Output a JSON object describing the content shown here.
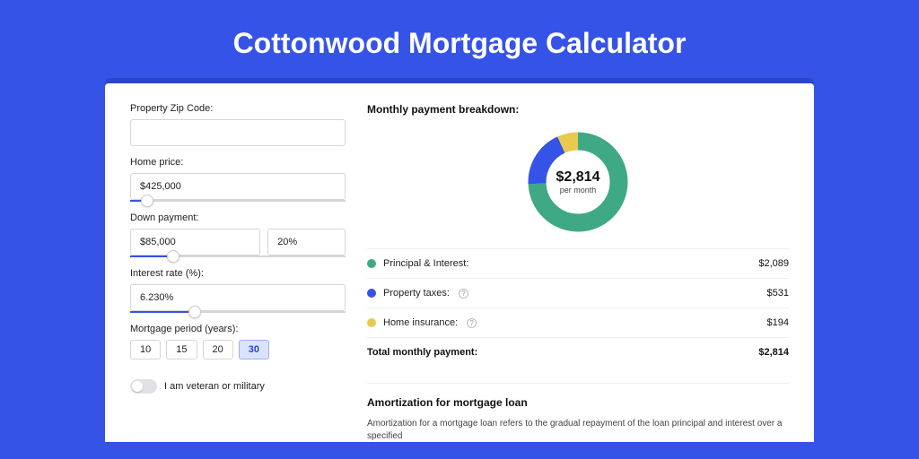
{
  "title": "Cottonwood Mortgage Calculator",
  "form": {
    "zip_label": "Property Zip Code:",
    "zip_value": "",
    "home_price_label": "Home price:",
    "home_price_value": "$425,000",
    "home_price_slider_pct": 8,
    "down_payment_label": "Down payment:",
    "down_payment_value": "$85,000",
    "down_payment_pct_value": "20%",
    "down_payment_slider_pct": 20,
    "interest_label": "Interest rate (%):",
    "interest_value": "6.230%",
    "interest_slider_pct": 30,
    "period_label": "Mortgage period (years):",
    "periods": [
      "10",
      "15",
      "20",
      "30"
    ],
    "period_selected": "30",
    "veteran_label": "I am veteran or military",
    "veteran_on": false
  },
  "breakdown": {
    "title": "Monthly payment breakdown:",
    "center_amount": "$2,814",
    "center_sub": "per month",
    "items": [
      {
        "label": "Principal & Interest:",
        "value": "$2,089",
        "color": "#3fa885",
        "info": false
      },
      {
        "label": "Property taxes:",
        "value": "$531",
        "color": "#3653e8",
        "info": true
      },
      {
        "label": "Home insurance:",
        "value": "$194",
        "color": "#eac94f",
        "info": true
      }
    ],
    "total_label": "Total monthly payment:",
    "total_value": "$2,814"
  },
  "chart_data": {
    "type": "pie",
    "title": "Monthly payment breakdown",
    "series": [
      {
        "name": "Principal & Interest",
        "value": 2089,
        "color": "#3fa885"
      },
      {
        "name": "Property taxes",
        "value": 531,
        "color": "#3653e8"
      },
      {
        "name": "Home insurance",
        "value": 194,
        "color": "#eac94f"
      }
    ],
    "total": 2814,
    "center_label": "$2,814 per month"
  },
  "amortization": {
    "title": "Amortization for mortgage loan",
    "text": "Amortization for a mortgage loan refers to the gradual repayment of the loan principal and interest over a specified"
  }
}
